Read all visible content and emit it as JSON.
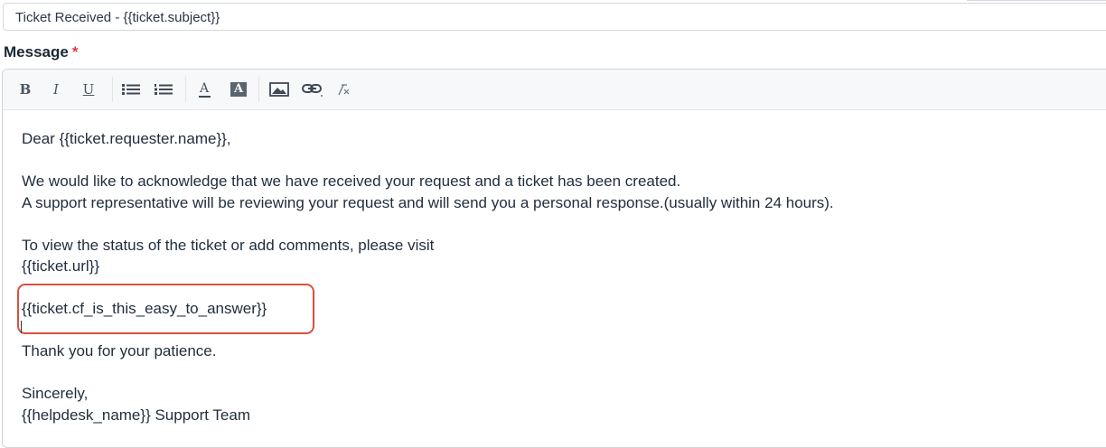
{
  "subject_field": {
    "value": "Ticket Received - {{ticket.subject}}"
  },
  "message_field": {
    "label": "Message",
    "required_marker": "*"
  },
  "toolbar": {
    "buttons": [
      {
        "name": "bold",
        "glyph": "B"
      },
      {
        "name": "italic",
        "glyph": "I"
      },
      {
        "name": "underline",
        "glyph": "U"
      },
      {
        "name": "bulleted-list",
        "icon": "bulleted-list-icon"
      },
      {
        "name": "numbered-list",
        "icon": "numbered-list-icon"
      },
      {
        "name": "text-color",
        "glyph": "A"
      },
      {
        "name": "background-color",
        "glyph": "A"
      },
      {
        "name": "insert-image",
        "icon": "image-icon"
      },
      {
        "name": "insert-link",
        "icon": "link-icon"
      },
      {
        "name": "clear-formatting",
        "icon": "clear-format-icon"
      }
    ]
  },
  "body": {
    "line1": "Dear {{ticket.requester.name}},",
    "line2": "",
    "line3": "We would like to acknowledge that we have received your request and a ticket has been created.",
    "line4": "A support representative will be reviewing your request and will send you a personal response.(usually within 24 hours).",
    "line5": "",
    "line6": "To view the status of the ticket or add comments, please visit",
    "line7": "{{ticket.url}}",
    "line8": "",
    "line9": "{{ticket.cf_is_this_easy_to_answer}}",
    "line10": "",
    "line11": "Thank you for your patience.",
    "line12": "",
    "line13": "Sincerely,",
    "line14": "{{helpdesk_name}} Support Team"
  },
  "colors": {
    "highlight_border": "#d9503d",
    "required_star": "#e43a45",
    "text": "#1f2d3d"
  }
}
